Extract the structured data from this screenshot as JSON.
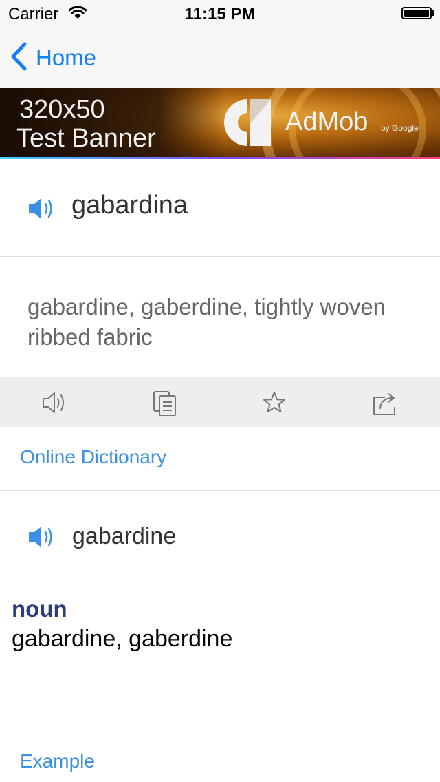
{
  "status": {
    "carrier": "Carrier",
    "time": "11:15 PM"
  },
  "nav": {
    "back_label": "Home"
  },
  "ad": {
    "line1": "320x50",
    "line2": "Test Banner",
    "brand": "AdMob",
    "by": "by Google"
  },
  "entry": {
    "word": "gabardina",
    "definition": " gabardine, gaberdine, tightly woven ribbed fabric"
  },
  "toolbar": {
    "icons": [
      "speaker-icon",
      "copy-icon",
      "star-icon",
      "share-icon"
    ]
  },
  "online": {
    "section_label": "Online Dictionary",
    "word": "gabardine",
    "part_of_speech": "noun",
    "translation": "gabardine, gaberdine",
    "example_label": "Example"
  },
  "colors": {
    "accent": "#157efb",
    "link": "#3b8fe5",
    "pos": "#2e3d7c",
    "toolbar_bg": "#eeeeee"
  }
}
